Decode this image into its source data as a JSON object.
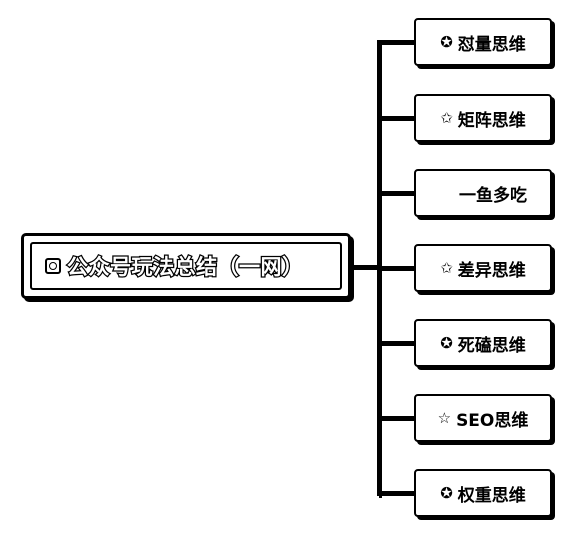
{
  "root": {
    "label": "公众号玩法总结（一网）",
    "icon": "instagram-icon"
  },
  "children": [
    {
      "label": "怼量思维",
      "icon": "star-filled",
      "glyph": "✪"
    },
    {
      "label": "矩阵思维",
      "icon": "star-outline",
      "glyph": "✩"
    },
    {
      "label": "一鱼多吃",
      "icon": "none",
      "glyph": ""
    },
    {
      "label": "差异思维",
      "icon": "star-outline",
      "glyph": "✩"
    },
    {
      "label": "死磕思维",
      "icon": "star-filled",
      "glyph": "✪"
    },
    {
      "label": "SEO思维",
      "icon": "star-outline",
      "glyph": "☆"
    },
    {
      "label": "权重思维",
      "icon": "star-filled",
      "glyph": "✪"
    }
  ]
}
